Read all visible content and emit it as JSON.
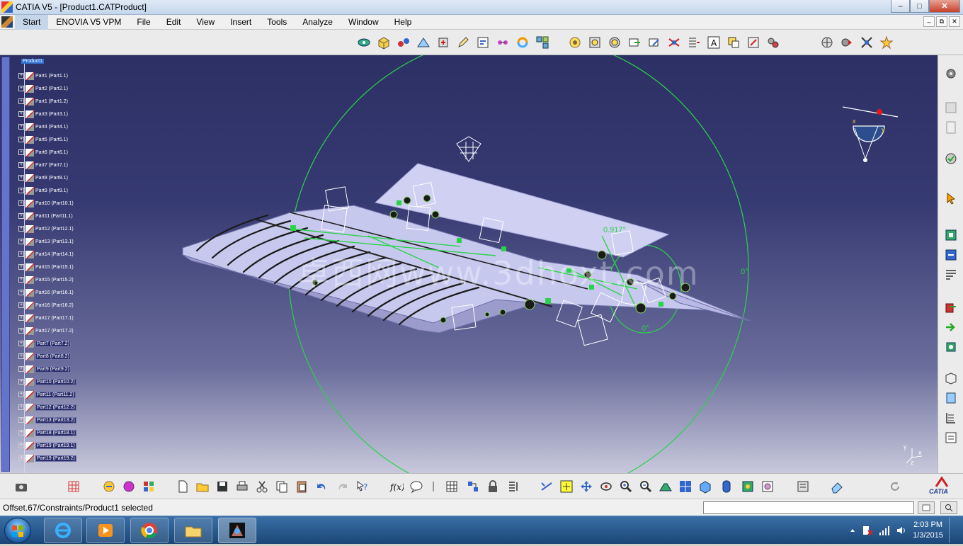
{
  "window": {
    "title": "CATIA V5 - [Product1.CATProduct]",
    "min": "‒",
    "max": "□",
    "close": "✕"
  },
  "menu": {
    "items": [
      "Start",
      "ENOVIA V5 VPM",
      "File",
      "Edit",
      "View",
      "Insert",
      "Tools",
      "Analyze",
      "Window",
      "Help"
    ],
    "doc_min": "‒",
    "doc_restore": "⧉",
    "doc_close": "✕"
  },
  "tree": {
    "root": "Product1",
    "nodes": [
      {
        "label": "Part1 (Part1.1)",
        "sel": false
      },
      {
        "label": "Part2 (Part2.1)",
        "sel": false
      },
      {
        "label": "Part1 (Part1.2)",
        "sel": false
      },
      {
        "label": "Part3 (Part3.1)",
        "sel": false
      },
      {
        "label": "Part4 (Part4.1)",
        "sel": false
      },
      {
        "label": "Part5 (Part5.1)",
        "sel": false
      },
      {
        "label": "Part6 (Part6.1)",
        "sel": false
      },
      {
        "label": "Part7 (Part7.1)",
        "sel": false
      },
      {
        "label": "Part8 (Part8.1)",
        "sel": false
      },
      {
        "label": "Part9 (Part9.1)",
        "sel": false
      },
      {
        "label": "Part10 (Part10.1)",
        "sel": false
      },
      {
        "label": "Part11 (Part11.1)",
        "sel": false
      },
      {
        "label": "Part12 (Part12.1)",
        "sel": false
      },
      {
        "label": "Part13 (Part13.1)",
        "sel": false
      },
      {
        "label": "Part14 (Part14.1)",
        "sel": false
      },
      {
        "label": "Part15 (Part15.1)",
        "sel": false
      },
      {
        "label": "Part15 (Part15.2)",
        "sel": false
      },
      {
        "label": "Part16 (Part16.1)",
        "sel": false
      },
      {
        "label": "Part16 (Part16.2)",
        "sel": false
      },
      {
        "label": "Part17 (Part17.1)",
        "sel": false
      },
      {
        "label": "Part17 (Part17.2)",
        "sel": false
      },
      {
        "label": "Part7 (Part7.2)",
        "sel": true
      },
      {
        "label": "Part8 (Part8.2)",
        "sel": true
      },
      {
        "label": "Part9 (Part9.2)",
        "sel": true
      },
      {
        "label": "Part10 (Part10.2)",
        "sel": true
      },
      {
        "label": "Part11 (Part11.2)",
        "sel": true
      },
      {
        "label": "Part12 (Part12.2)",
        "sel": true
      },
      {
        "label": "Part13 (Part13.2)",
        "sel": true
      },
      {
        "label": "Part18 (Part18.1)",
        "sel": true
      },
      {
        "label": "Part19 (Part19.1)",
        "sel": true
      },
      {
        "label": "Part19 (Part19.2)",
        "sel": true
      }
    ]
  },
  "viewport": {
    "angle_label_1": "0.917°",
    "angle_label_2": "0°",
    "angle_label_3": "0°",
    "watermark": "卓西网www.3dhoxt.com",
    "axis_x": "x",
    "axis_y": "y",
    "axis_z": "z",
    "compass_x": "x",
    "compass_y": "y"
  },
  "brand": {
    "logo_text": "CATIA"
  },
  "status": {
    "message": "Offset.67/Constraints/Product1 selected",
    "cmd_value": ""
  },
  "taskbar": {
    "time": "2:03 PM",
    "date": "1/3/2015"
  },
  "colors": {
    "accent": "#2f6fd2",
    "constraint_green": "#22dd33",
    "viewport_top": "#2c3064"
  }
}
